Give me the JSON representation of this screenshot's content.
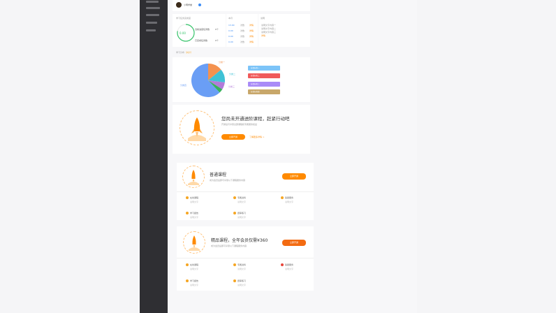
{
  "colors": {
    "accent": "#ff8a00",
    "sidebar_bg": "#2f2f33",
    "pie_orange": "#f4924f",
    "pie_teal": "#3fc2d6",
    "pie_purple": "#b27bd9",
    "pie_green": "#38b25c",
    "pie_blue": "#6a9ef5",
    "pill_blue": "#7cc4f8",
    "pill_red": "#f05a5a",
    "pill_purple": "#a98bf7",
    "pill_tan": "#c8a76a"
  },
  "sidebar": {
    "items": [
      "",
      "",
      "",
      "",
      ""
    ]
  },
  "profile": {
    "name": "小明学堂",
    "badge_icon": "verified-icon"
  },
  "stats": {
    "progress_title": "学习任务完成度",
    "progress_value": "0.00",
    "progress_fraction": 0.78,
    "rows": [
      {
        "label": "当前进度任务数",
        "value": "0个"
      },
      {
        "label": "已完成任务数",
        "value": "0个"
      }
    ],
    "mid_title": "本月",
    "mid_rows": [
      {
        "num": "13.00",
        "unit": "次数",
        "tag": "详情"
      },
      {
        "num": "0.00",
        "unit": "次数",
        "tag": "详情"
      },
      {
        "num": "0.00",
        "unit": "次数",
        "tag": "详情"
      },
      {
        "num": "0.00",
        "unit": "次数",
        "tag": "详情"
      }
    ],
    "right_title": "说明",
    "right_lines": [
      "说明文字内容一",
      "说明文字内容二",
      "说明文字内容三"
    ],
    "right_tag": "详情"
  },
  "pie_section": {
    "title": "学习分布",
    "title_tag": "（共计）",
    "labels": [
      "分类一",
      "分类二",
      "分类三",
      "分类四"
    ],
    "legend": [
      "分类标签一",
      "分类标签二",
      "分类标签三",
      "分类标签四"
    ]
  },
  "chart_data": {
    "type": "pie",
    "title": "",
    "slices": [
      {
        "label": "",
        "value": 14,
        "color": "#f4924f"
      },
      {
        "label": "",
        "value": 13,
        "color": "#3fc2d6"
      },
      {
        "label": "",
        "value": 7,
        "color": "#b27bd9"
      },
      {
        "label": "",
        "value": 4,
        "color": "#38b25c"
      },
      {
        "label": "",
        "value": 62,
        "color": "#6a9ef5"
      }
    ]
  },
  "promo": {
    "title": "您尚未开通进阶课程，赶紧行动吧",
    "subtitle": "开通后可享受全部课程和专属服务权益",
    "button": "立即开通",
    "link": "了解更多详情 >"
  },
  "plans": [
    {
      "title": "普通课程",
      "desc": "成为会员后即可享受以下课程服务内容",
      "button": "立即开通",
      "features": [
        {
          "name": "在线课程",
          "note": "说明文字"
        },
        {
          "name": "专属资料",
          "note": "说明文字"
        },
        {
          "name": "答疑服务",
          "note": "说明文字"
        },
        {
          "name": "学习报告",
          "note": "说明文字"
        },
        {
          "name": "题库练习",
          "note": "说明文字"
        }
      ]
    },
    {
      "title": "精品课程，全年会员仅需¥360",
      "desc": "成为会员后即可享受以下课程服务内容",
      "button": "立即开通",
      "features": [
        {
          "name": "在线课程",
          "note": "说明文字"
        },
        {
          "name": "专属资料",
          "note": "说明文字"
        },
        {
          "name": "答疑服务",
          "note": "说明文字"
        },
        {
          "name": "学习报告",
          "note": "说明文字"
        },
        {
          "name": "题库练习",
          "note": "说明文字"
        }
      ]
    }
  ]
}
